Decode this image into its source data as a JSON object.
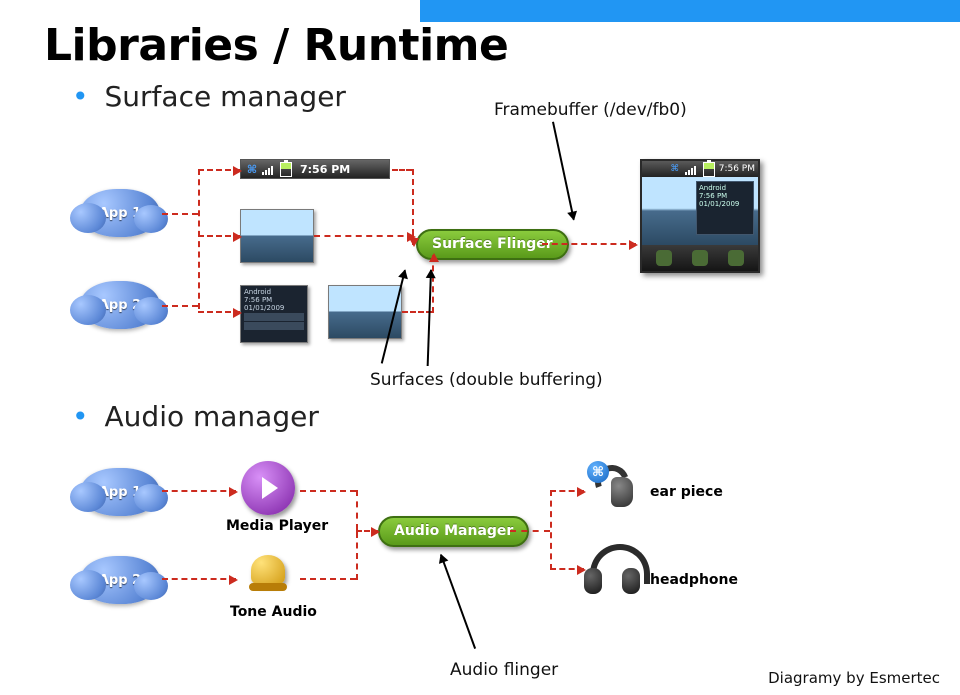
{
  "title": "Libraries / Runtime",
  "bullets": {
    "surface_manager": "Surface manager",
    "audio_manager": "Audio manager"
  },
  "surface_diagram": {
    "app1": "App 1",
    "app2": "App 2",
    "status_bar": {
      "time": "7:56 PM"
    },
    "flinger_label": "Surface Flinger",
    "phone_status": {
      "time": "7:56 PM"
    },
    "phone_widget": {
      "line1": "Android",
      "line2": "7:56 PM",
      "line3": "01/01/2009"
    },
    "dark_thumb": {
      "line1": "Android",
      "line2": "7:56 PM",
      "line3": "01/01/2009"
    }
  },
  "annotations": {
    "framebuffer": "Framebuffer (/dev/fb0)",
    "surfaces_dbl": "Surfaces (double buffering)",
    "audio_flinger": "Audio flinger"
  },
  "audio_diagram": {
    "app1": "App 1",
    "app2": "App 2",
    "media_player": "Media Player",
    "tone_audio": "Tone Audio",
    "manager_label": "Audio Manager",
    "ear_piece": "ear piece",
    "headphone": "headphone"
  },
  "credit": "Diagramy by Esmertec"
}
